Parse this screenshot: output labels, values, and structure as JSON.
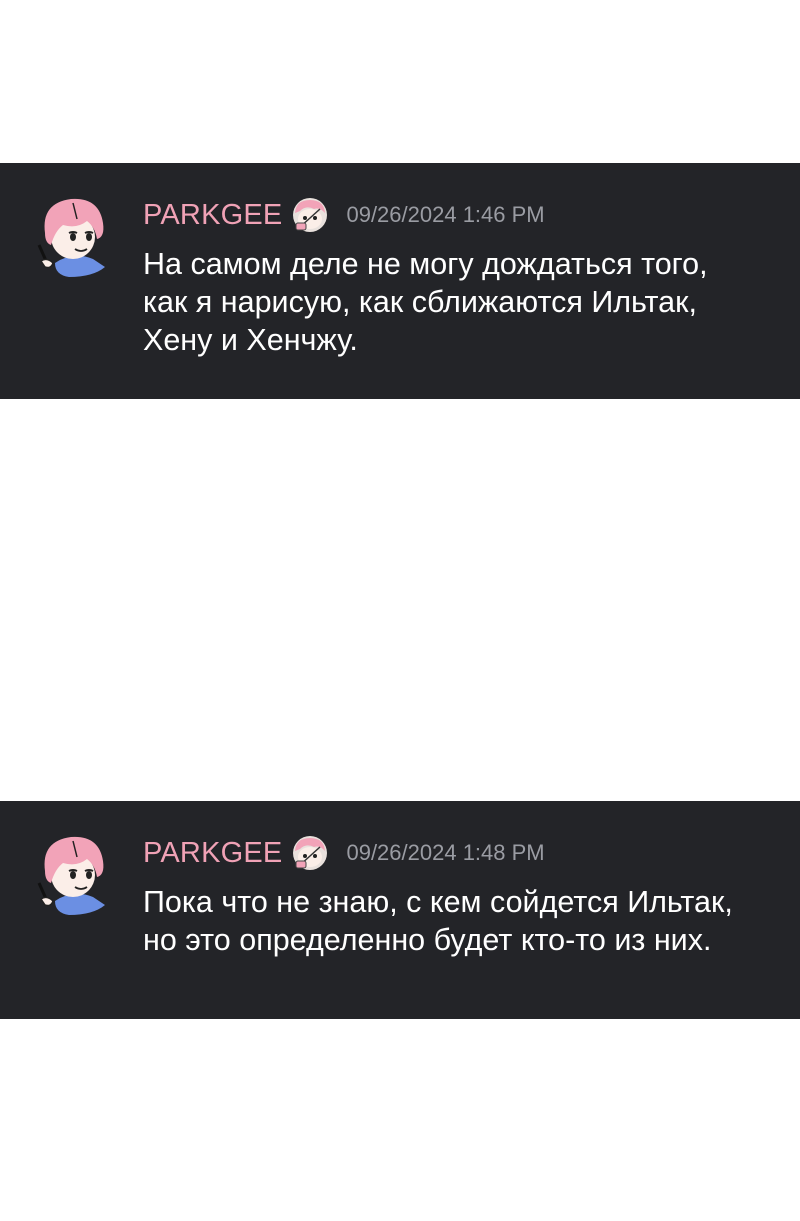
{
  "messages": [
    {
      "username": "PARKGEE",
      "timestamp": "09/26/2024 1:46 PM",
      "lines": [
        "На самом деле не могу дождаться того,",
        "как я нарисую, как сближаются Ильтак,",
        "Хену и Хенчжу."
      ]
    },
    {
      "username": "PARKGEE",
      "timestamp": "09/26/2024 1:48 PM",
      "lines": [
        "Пока что не знаю, с кем сойдется Ильтак,",
        "но это определенно будет кто-то из них."
      ]
    }
  ],
  "icons": {
    "avatar": "avatar-icon",
    "badge": "profile-badge-icon"
  },
  "colors": {
    "message_background": "#232428",
    "username": "#f0a2b6",
    "timestamp": "#9a9ca3",
    "text": "#ffffff",
    "page_background": "#ffffff"
  }
}
